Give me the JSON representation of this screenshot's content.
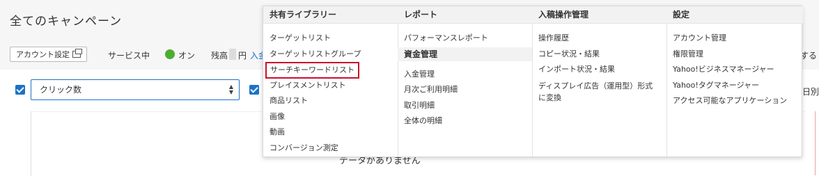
{
  "page": {
    "title": "全てのキャンペーン",
    "account_settings_label": "アカウント設定",
    "service_label": "サービス中",
    "on_label": "オン",
    "balance_label": "残高",
    "yen_label": "円",
    "deposit_link": "入金",
    "right_snippet_1": "する",
    "right_snippet_2": "日別",
    "status_color": "#4cae2f",
    "accent_color": "#1a73c8"
  },
  "metrics": {
    "metric_1": "クリック数"
  },
  "chart": {
    "no_data": "データがありません"
  },
  "menu": {
    "shared_library": {
      "header": "共有ライブラリー",
      "items": [
        "ターゲットリスト",
        "ターゲットリストグループ",
        "サーチキーワードリスト",
        "プレイスメントリスト",
        "商品リスト",
        "画像",
        "動画",
        "コンバージョン測定"
      ],
      "highlighted_index": 2
    },
    "reports": {
      "header": "レポート",
      "items": [
        "パフォーマンスレポート"
      ]
    },
    "funds": {
      "header": "資金管理",
      "items": [
        "入金管理",
        "月次ご利用明細",
        "取引明細",
        "全体の明細"
      ]
    },
    "submission": {
      "header": "入稿操作管理",
      "items": [
        "操作履歴",
        "コピー状況・結果",
        "インポート状況・結果",
        "ディスプレイ広告（運用型）形式に変換"
      ]
    },
    "settings": {
      "header": "設定",
      "items": [
        "アカウント管理",
        "権限管理",
        "Yahoo!ビジネスマネージャー",
        "Yahoo!タグマネージャー",
        "アクセス可能なアプリケーション"
      ]
    }
  }
}
